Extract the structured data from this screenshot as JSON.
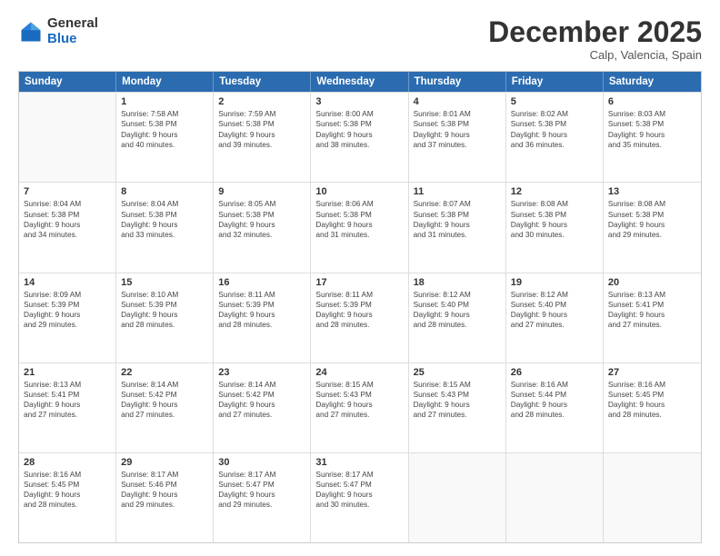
{
  "logo": {
    "general": "General",
    "blue": "Blue"
  },
  "header": {
    "month": "December 2025",
    "location": "Calp, Valencia, Spain"
  },
  "weekdays": [
    "Sunday",
    "Monday",
    "Tuesday",
    "Wednesday",
    "Thursday",
    "Friday",
    "Saturday"
  ],
  "rows": [
    [
      {
        "day": "",
        "lines": []
      },
      {
        "day": "1",
        "lines": [
          "Sunrise: 7:58 AM",
          "Sunset: 5:38 PM",
          "Daylight: 9 hours",
          "and 40 minutes."
        ]
      },
      {
        "day": "2",
        "lines": [
          "Sunrise: 7:59 AM",
          "Sunset: 5:38 PM",
          "Daylight: 9 hours",
          "and 39 minutes."
        ]
      },
      {
        "day": "3",
        "lines": [
          "Sunrise: 8:00 AM",
          "Sunset: 5:38 PM",
          "Daylight: 9 hours",
          "and 38 minutes."
        ]
      },
      {
        "day": "4",
        "lines": [
          "Sunrise: 8:01 AM",
          "Sunset: 5:38 PM",
          "Daylight: 9 hours",
          "and 37 minutes."
        ]
      },
      {
        "day": "5",
        "lines": [
          "Sunrise: 8:02 AM",
          "Sunset: 5:38 PM",
          "Daylight: 9 hours",
          "and 36 minutes."
        ]
      },
      {
        "day": "6",
        "lines": [
          "Sunrise: 8:03 AM",
          "Sunset: 5:38 PM",
          "Daylight: 9 hours",
          "and 35 minutes."
        ]
      }
    ],
    [
      {
        "day": "7",
        "lines": [
          "Sunrise: 8:04 AM",
          "Sunset: 5:38 PM",
          "Daylight: 9 hours",
          "and 34 minutes."
        ]
      },
      {
        "day": "8",
        "lines": [
          "Sunrise: 8:04 AM",
          "Sunset: 5:38 PM",
          "Daylight: 9 hours",
          "and 33 minutes."
        ]
      },
      {
        "day": "9",
        "lines": [
          "Sunrise: 8:05 AM",
          "Sunset: 5:38 PM",
          "Daylight: 9 hours",
          "and 32 minutes."
        ]
      },
      {
        "day": "10",
        "lines": [
          "Sunrise: 8:06 AM",
          "Sunset: 5:38 PM",
          "Daylight: 9 hours",
          "and 31 minutes."
        ]
      },
      {
        "day": "11",
        "lines": [
          "Sunrise: 8:07 AM",
          "Sunset: 5:38 PM",
          "Daylight: 9 hours",
          "and 31 minutes."
        ]
      },
      {
        "day": "12",
        "lines": [
          "Sunrise: 8:08 AM",
          "Sunset: 5:38 PM",
          "Daylight: 9 hours",
          "and 30 minutes."
        ]
      },
      {
        "day": "13",
        "lines": [
          "Sunrise: 8:08 AM",
          "Sunset: 5:38 PM",
          "Daylight: 9 hours",
          "and 29 minutes."
        ]
      }
    ],
    [
      {
        "day": "14",
        "lines": [
          "Sunrise: 8:09 AM",
          "Sunset: 5:39 PM",
          "Daylight: 9 hours",
          "and 29 minutes."
        ]
      },
      {
        "day": "15",
        "lines": [
          "Sunrise: 8:10 AM",
          "Sunset: 5:39 PM",
          "Daylight: 9 hours",
          "and 28 minutes."
        ]
      },
      {
        "day": "16",
        "lines": [
          "Sunrise: 8:11 AM",
          "Sunset: 5:39 PM",
          "Daylight: 9 hours",
          "and 28 minutes."
        ]
      },
      {
        "day": "17",
        "lines": [
          "Sunrise: 8:11 AM",
          "Sunset: 5:39 PM",
          "Daylight: 9 hours",
          "and 28 minutes."
        ]
      },
      {
        "day": "18",
        "lines": [
          "Sunrise: 8:12 AM",
          "Sunset: 5:40 PM",
          "Daylight: 9 hours",
          "and 28 minutes."
        ]
      },
      {
        "day": "19",
        "lines": [
          "Sunrise: 8:12 AM",
          "Sunset: 5:40 PM",
          "Daylight: 9 hours",
          "and 27 minutes."
        ]
      },
      {
        "day": "20",
        "lines": [
          "Sunrise: 8:13 AM",
          "Sunset: 5:41 PM",
          "Daylight: 9 hours",
          "and 27 minutes."
        ]
      }
    ],
    [
      {
        "day": "21",
        "lines": [
          "Sunrise: 8:13 AM",
          "Sunset: 5:41 PM",
          "Daylight: 9 hours",
          "and 27 minutes."
        ]
      },
      {
        "day": "22",
        "lines": [
          "Sunrise: 8:14 AM",
          "Sunset: 5:42 PM",
          "Daylight: 9 hours",
          "and 27 minutes."
        ]
      },
      {
        "day": "23",
        "lines": [
          "Sunrise: 8:14 AM",
          "Sunset: 5:42 PM",
          "Daylight: 9 hours",
          "and 27 minutes."
        ]
      },
      {
        "day": "24",
        "lines": [
          "Sunrise: 8:15 AM",
          "Sunset: 5:43 PM",
          "Daylight: 9 hours",
          "and 27 minutes."
        ]
      },
      {
        "day": "25",
        "lines": [
          "Sunrise: 8:15 AM",
          "Sunset: 5:43 PM",
          "Daylight: 9 hours",
          "and 27 minutes."
        ]
      },
      {
        "day": "26",
        "lines": [
          "Sunrise: 8:16 AM",
          "Sunset: 5:44 PM",
          "Daylight: 9 hours",
          "and 28 minutes."
        ]
      },
      {
        "day": "27",
        "lines": [
          "Sunrise: 8:16 AM",
          "Sunset: 5:45 PM",
          "Daylight: 9 hours",
          "and 28 minutes."
        ]
      }
    ],
    [
      {
        "day": "28",
        "lines": [
          "Sunrise: 8:16 AM",
          "Sunset: 5:45 PM",
          "Daylight: 9 hours",
          "and 28 minutes."
        ]
      },
      {
        "day": "29",
        "lines": [
          "Sunrise: 8:17 AM",
          "Sunset: 5:46 PM",
          "Daylight: 9 hours",
          "and 29 minutes."
        ]
      },
      {
        "day": "30",
        "lines": [
          "Sunrise: 8:17 AM",
          "Sunset: 5:47 PM",
          "Daylight: 9 hours",
          "and 29 minutes."
        ]
      },
      {
        "day": "31",
        "lines": [
          "Sunrise: 8:17 AM",
          "Sunset: 5:47 PM",
          "Daylight: 9 hours",
          "and 30 minutes."
        ]
      },
      {
        "day": "",
        "lines": []
      },
      {
        "day": "",
        "lines": []
      },
      {
        "day": "",
        "lines": []
      }
    ]
  ]
}
